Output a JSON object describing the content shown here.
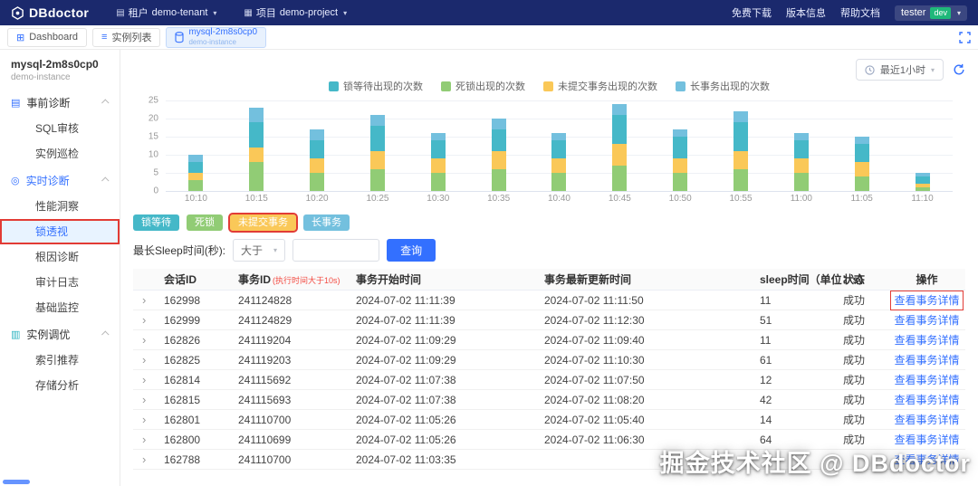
{
  "navbar": {
    "logo_text": "DBdoctor",
    "tenant": {
      "label": "租户",
      "value": "demo-tenant"
    },
    "project": {
      "label": "项目",
      "value": "demo-project"
    },
    "links": [
      {
        "name": "free-download",
        "label": "免费下载"
      },
      {
        "name": "version-info",
        "label": "版本信息"
      },
      {
        "name": "help-docs",
        "label": "帮助文档"
      }
    ],
    "user": {
      "name": "tester",
      "badge": "dev"
    }
  },
  "tabbar": {
    "tabs": [
      {
        "label": "Dashboard"
      },
      {
        "label": "实例列表"
      },
      {
        "label": "mysql-2m8s0cp0",
        "sublabel": "demo-instance"
      }
    ]
  },
  "sidebar": {
    "instance_name": "mysql-2m8s0cp0",
    "instance_sublabel": "demo-instance",
    "groups": [
      {
        "name": "pre-diagnosis",
        "label": "事前诊断",
        "icon": "pre-diagnosis-icon",
        "active": false,
        "items": [
          {
            "name": "sql-audit",
            "label": "SQL审核"
          },
          {
            "name": "instance-inspection",
            "label": "实例巡检"
          }
        ]
      },
      {
        "name": "realtime-diagnosis",
        "label": "实时诊断",
        "icon": "realtime-diagnosis-icon",
        "active": true,
        "items": [
          {
            "name": "performance-insight",
            "label": "性能洞察"
          },
          {
            "name": "lock-perspective",
            "label": "锁透视",
            "active": true,
            "annotated": true
          },
          {
            "name": "root-cause-diagnosis",
            "label": "根因诊断"
          },
          {
            "name": "audit-log",
            "label": "审计日志"
          },
          {
            "name": "basic-monitoring",
            "label": "基础监控"
          }
        ]
      },
      {
        "name": "instance-tuning",
        "label": "实例调优",
        "icon": "instance-tuning-icon",
        "active": false,
        "items": [
          {
            "name": "index-recommendation",
            "label": "索引推荐"
          },
          {
            "name": "storage-analysis",
            "label": "存储分析"
          }
        ]
      }
    ]
  },
  "toolbar": {
    "time_range": "最近1小时"
  },
  "chart_data": {
    "type": "bar",
    "stacked": true,
    "categories": [
      "10:10",
      "10:15",
      "10:20",
      "10:25",
      "10:30",
      "10:35",
      "10:40",
      "10:45",
      "10:50",
      "10:55",
      "11:00",
      "11:05",
      "11:10"
    ],
    "series": [
      {
        "name": "死锁出现的次数",
        "color": "#91cc75",
        "values": [
          3,
          8,
          5,
          6,
          5,
          6,
          5,
          7,
          5,
          6,
          5,
          4,
          1
        ]
      },
      {
        "name": "未提交事务出现的次数",
        "color": "#fac858",
        "values": [
          2,
          4,
          4,
          5,
          4,
          5,
          4,
          6,
          4,
          5,
          4,
          4,
          1
        ]
      },
      {
        "name": "锁等待出现的次数",
        "color": "#45b8c8",
        "values": [
          3,
          7,
          5,
          7,
          5,
          6,
          5,
          8,
          6,
          8,
          5,
          5,
          2
        ]
      },
      {
        "name": "长事务出现的次数",
        "color": "#73c0de",
        "values": [
          2,
          4,
          3,
          3,
          2,
          3,
          2,
          3,
          2,
          3,
          2,
          2,
          1
        ]
      }
    ],
    "legend": [
      "锁等待出现的次数",
      "死锁出现的次数",
      "未提交事务出现的次数",
      "长事务出现的次数"
    ],
    "legend_colors": [
      "#45b8c8",
      "#91cc75",
      "#fac858",
      "#73c0de"
    ],
    "ylim": [
      0,
      25
    ],
    "yticks": [
      25,
      20,
      15,
      10,
      5,
      0
    ],
    "legend_position": "top",
    "grid": true
  },
  "filters": {
    "chips": [
      {
        "name": "lock-wait",
        "label": "锁等待",
        "color": "#45b8c8"
      },
      {
        "name": "deadlock",
        "label": "死锁",
        "color": "#91cc75"
      },
      {
        "name": "uncommitted-transaction",
        "label": "未提交事务",
        "color": "#fac858",
        "annotated": true
      },
      {
        "name": "long-transaction",
        "label": "长事务",
        "color": "#73c0de"
      }
    ],
    "sleep_label": "最长Sleep时间(秒):",
    "operator_value": "大于",
    "input_value": "",
    "search_label": "查询"
  },
  "table": {
    "headers": {
      "session_id": "会话ID",
      "txn_id": "事务ID",
      "txn_id_note": "(执行时间大于10s)",
      "start_time": "事务开始时间",
      "update_time": "事务最新更新时间",
      "sleep": "sleep时间（单位：s）",
      "status": "状态",
      "action": "操作"
    },
    "action_label": "查看事务详情",
    "rows": [
      {
        "session_id": "162998",
        "txn_id": "241124828",
        "start_time": "2024-07-02 11:11:39",
        "update_time": "2024-07-02 11:11:50",
        "sleep": "11",
        "status": "成功",
        "annotated": true
      },
      {
        "session_id": "162999",
        "txn_id": "241124829",
        "start_time": "2024-07-02 11:11:39",
        "update_time": "2024-07-02 11:12:30",
        "sleep": "51",
        "status": "成功"
      },
      {
        "session_id": "162826",
        "txn_id": "241119204",
        "start_time": "2024-07-02 11:09:29",
        "update_time": "2024-07-02 11:09:40",
        "sleep": "11",
        "status": "成功"
      },
      {
        "session_id": "162825",
        "txn_id": "241119203",
        "start_time": "2024-07-02 11:09:29",
        "update_time": "2024-07-02 11:10:30",
        "sleep": "61",
        "status": "成功"
      },
      {
        "session_id": "162814",
        "txn_id": "241115692",
        "start_time": "2024-07-02 11:07:38",
        "update_time": "2024-07-02 11:07:50",
        "sleep": "12",
        "status": "成功"
      },
      {
        "session_id": "162815",
        "txn_id": "241115693",
        "start_time": "2024-07-02 11:07:38",
        "update_time": "2024-07-02 11:08:20",
        "sleep": "42",
        "status": "成功"
      },
      {
        "session_id": "162801",
        "txn_id": "241110700",
        "start_time": "2024-07-02 11:05:26",
        "update_time": "2024-07-02 11:05:40",
        "sleep": "14",
        "status": "成功"
      },
      {
        "session_id": "162800",
        "txn_id": "241110699",
        "start_time": "2024-07-02 11:05:26",
        "update_time": "2024-07-02 11:06:30",
        "sleep": "64",
        "status": "成功"
      },
      {
        "session_id": "162788",
        "txn_id": "241110700",
        "start_time": "2024-07-02 11:03:35",
        "update_time": "",
        "sleep": "",
        "status": ""
      }
    ]
  },
  "watermark": "掘金技术社区 @ DBdoctor"
}
